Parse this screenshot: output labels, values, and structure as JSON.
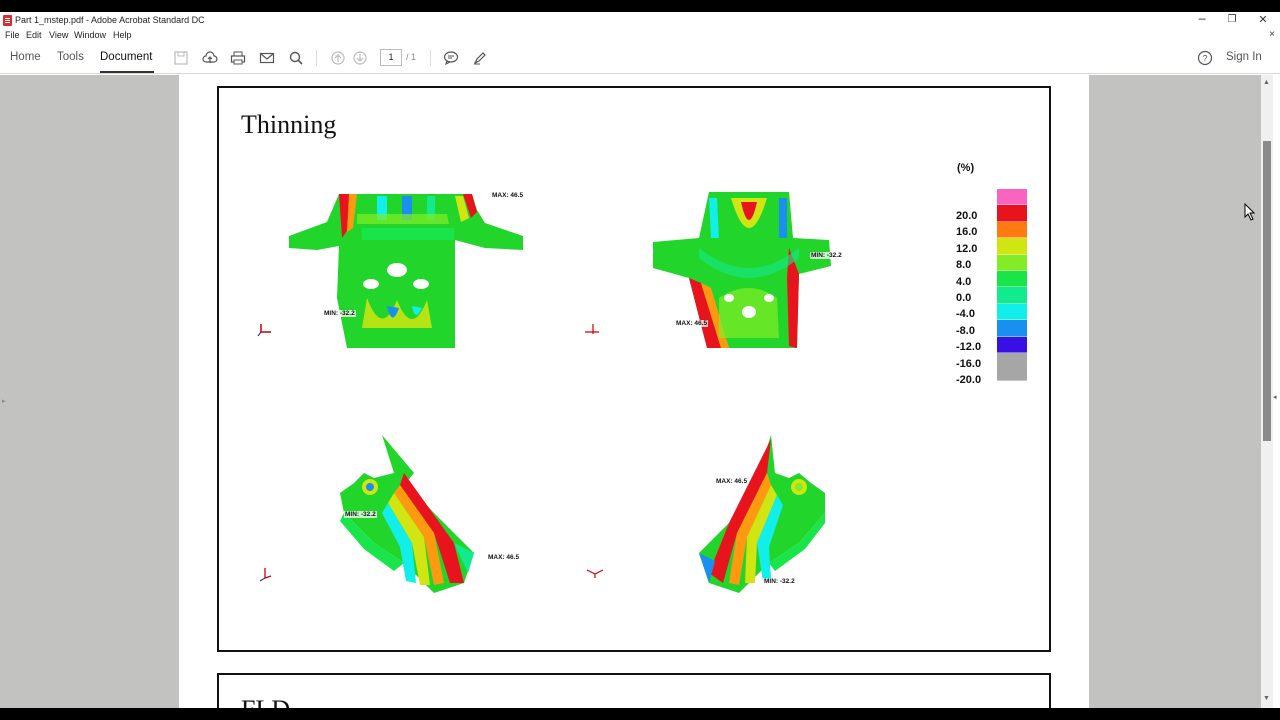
{
  "window": {
    "title": "Part 1_mstep.pdf - Adobe Acrobat Standard DC",
    "minimize": "─",
    "restore": "❐",
    "close": "✕"
  },
  "menu": {
    "items": [
      "File",
      "Edit",
      "View",
      "Window",
      "Help"
    ],
    "close_doc": "×"
  },
  "toolbar": {
    "tabs": [
      "Home",
      "Tools",
      "Document"
    ],
    "active_tab": "Document",
    "page_current": "1",
    "page_total": "/ 1",
    "sign_in": "Sign In",
    "help": "?"
  },
  "slide": {
    "title": "Thinning",
    "max_label": "MAX: 46.5",
    "min_label": "MIN: -32.2",
    "unit": "(%)",
    "legend": {
      "labels": [
        "20.0",
        "16.0",
        "12.0",
        "8.0",
        "4.0",
        "0.0",
        "-4.0",
        "-8.0",
        "-12.0",
        "-16.0",
        "-20.0"
      ],
      "colors": [
        "#f765c0",
        "#e8141d",
        "#ff7a10",
        "#d0e511",
        "#82ec26",
        "#19e54a",
        "#12ea8e",
        "#12eee9",
        "#1a8ff0",
        "#3810e6",
        "#a6a6a6"
      ]
    }
  },
  "next_slide": {
    "title": "FLD"
  },
  "colors": {
    "part_green": "#22d52b",
    "accent_red": "#e8141d"
  }
}
